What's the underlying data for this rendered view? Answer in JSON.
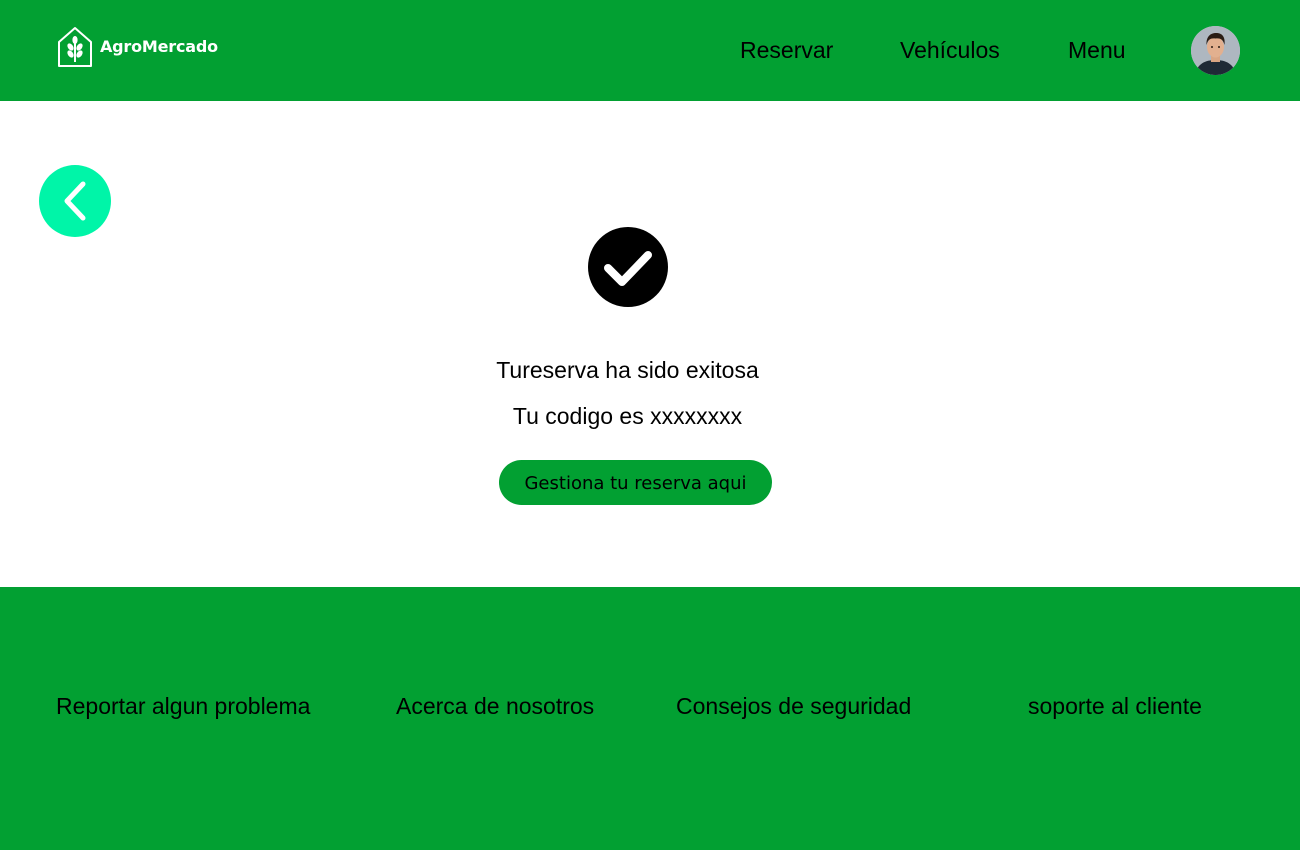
{
  "colors": {
    "primary_green": "#02a032",
    "back_button": "#00f5a8",
    "text": "#000000",
    "background": "#ffffff"
  },
  "header": {
    "logo_text": "AgroMercado",
    "logo_icon": "house-wheat-icon",
    "nav": {
      "reservar": "Reservar",
      "vehiculos": "Vehículos",
      "menu": "Menu"
    },
    "avatar_icon": "user-avatar"
  },
  "main": {
    "back_icon": "chevron-left-icon",
    "success_icon": "check-circle-icon",
    "success_message": "Tureserva ha sido exitosa",
    "code_message": "Tu codigo es xxxxxxxx",
    "manage_button_label": "Gestiona tu reserva aqui"
  },
  "footer": {
    "links": {
      "report": "Reportar algun problema",
      "about": "Acerca de nosotros",
      "safety": "Consejos de seguridad",
      "support": "soporte al cliente"
    }
  }
}
